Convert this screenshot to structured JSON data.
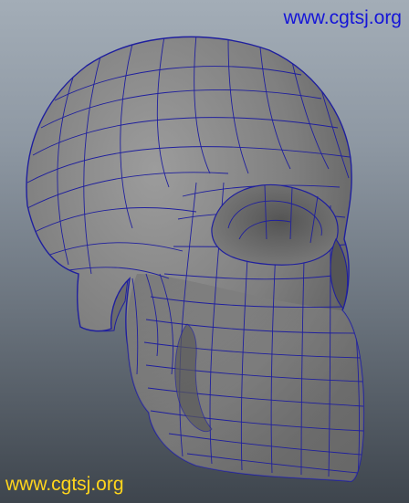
{
  "viewport": {
    "watermark_top": "www.cgtsj.org",
    "watermark_bottom": "www.cgtsj.org",
    "watermark_top_color": "#1515d8",
    "watermark_bottom_color": "#ffd51c",
    "wire_color": "#1f1f9e"
  }
}
